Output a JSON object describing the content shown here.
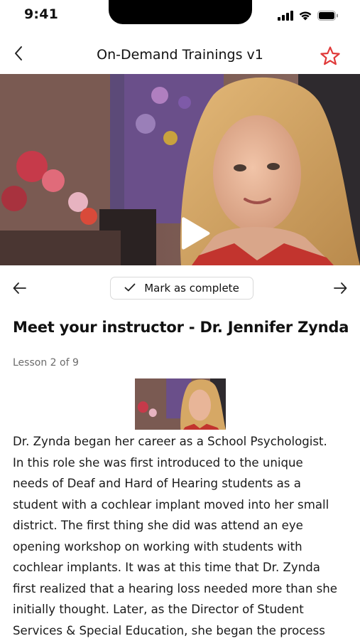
{
  "status_bar": {
    "time": "9:41",
    "icons": [
      "cellular-signal-icon",
      "wifi-icon",
      "battery-icon"
    ]
  },
  "nav": {
    "back_icon": "chevron-left-icon",
    "title": "On-Demand Trainings v1",
    "favorite_icon": "star-outline-icon",
    "favorite_color": "#e03a3a"
  },
  "video": {
    "play_icon": "play-icon"
  },
  "lesson_controls": {
    "prev_icon": "arrow-left-icon",
    "next_icon": "arrow-right-icon",
    "mark_complete_label": "Mark as complete",
    "check_icon": "checkmark-icon"
  },
  "lesson": {
    "title": "Meet your instructor - Dr. Jennifer Zynda",
    "count": "Lesson 2 of 9",
    "description_lines": [
      "Dr. Zynda began her career as a School Psychologist.",
      "In this role she was first introduced to the unique",
      "needs of Deaf and Hard of Hearing students as a",
      "student with a cochlear implant moved into her small",
      "district. The first thing she did was attend an eye",
      "opening workshop on working with students with",
      "cochlear implants. It was at this time that Dr. Zynda",
      "first realized that a hearing loss needed more than she",
      "initially thought. Later, as the Director of Student",
      "Services & Special Education, she began the process"
    ]
  }
}
